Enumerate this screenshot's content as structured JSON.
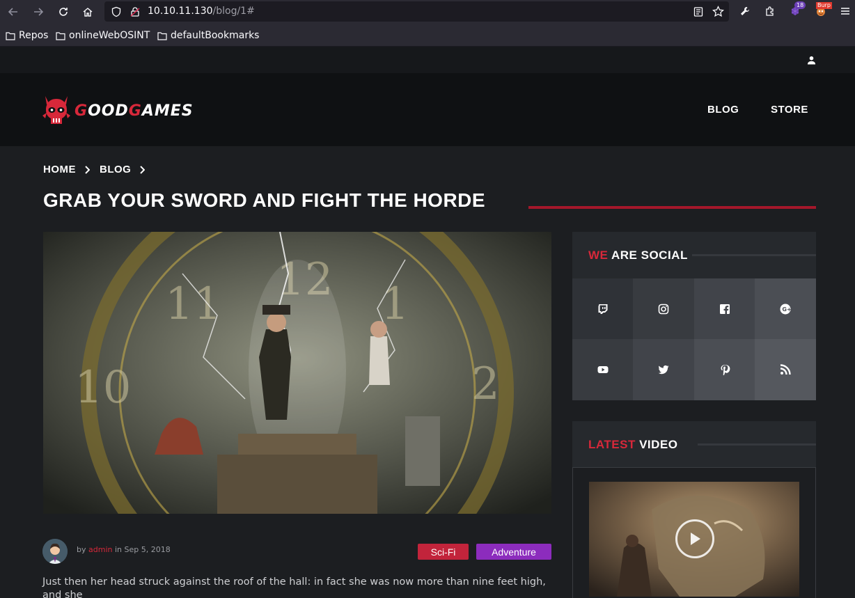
{
  "browser": {
    "url_host": "10.10.11.130",
    "url_path": "/blog/1#",
    "extension_badge_count": "18",
    "burp_badge_label": "Burp",
    "bookmarks": [
      "Repos",
      "onlineWebOSINT",
      "defaultBookmarks"
    ]
  },
  "site": {
    "logo_text_g1": "G",
    "logo_text_1": "OOD",
    "logo_text_g2": "G",
    "logo_text_2": "AMES",
    "nav": {
      "blog": "BLOG",
      "store": "STORE"
    }
  },
  "breadcrumb": {
    "home": "HOME",
    "blog": "BLOG"
  },
  "post": {
    "title": "GRAB YOUR SWORD AND FIGHT THE HORDE",
    "by_label": "by",
    "author": "admin",
    "in_label": "in",
    "date": "Sep 5, 2018",
    "tags": [
      "Sci-Fi",
      "Adventure"
    ],
    "body": "Just then her head struck against the roof of the hall: in fact she was now more than nine feet high, and she"
  },
  "sidebar": {
    "social": {
      "title_accent": "WE",
      "title_rest": "ARE SOCIAL",
      "icons": [
        "twitch-icon",
        "instagram-icon",
        "facebook-icon",
        "google-plus-icon",
        "youtube-icon",
        "twitter-icon",
        "pinterest-icon",
        "rss-icon"
      ]
    },
    "video": {
      "title_accent": "LATEST",
      "title_rest": "VIDEO"
    }
  },
  "colors": {
    "accent_red": "#d7283a",
    "tag_scifi": "#c2243b",
    "tag_adventure": "#8c2cbd",
    "title_underline": "#a4172b"
  }
}
